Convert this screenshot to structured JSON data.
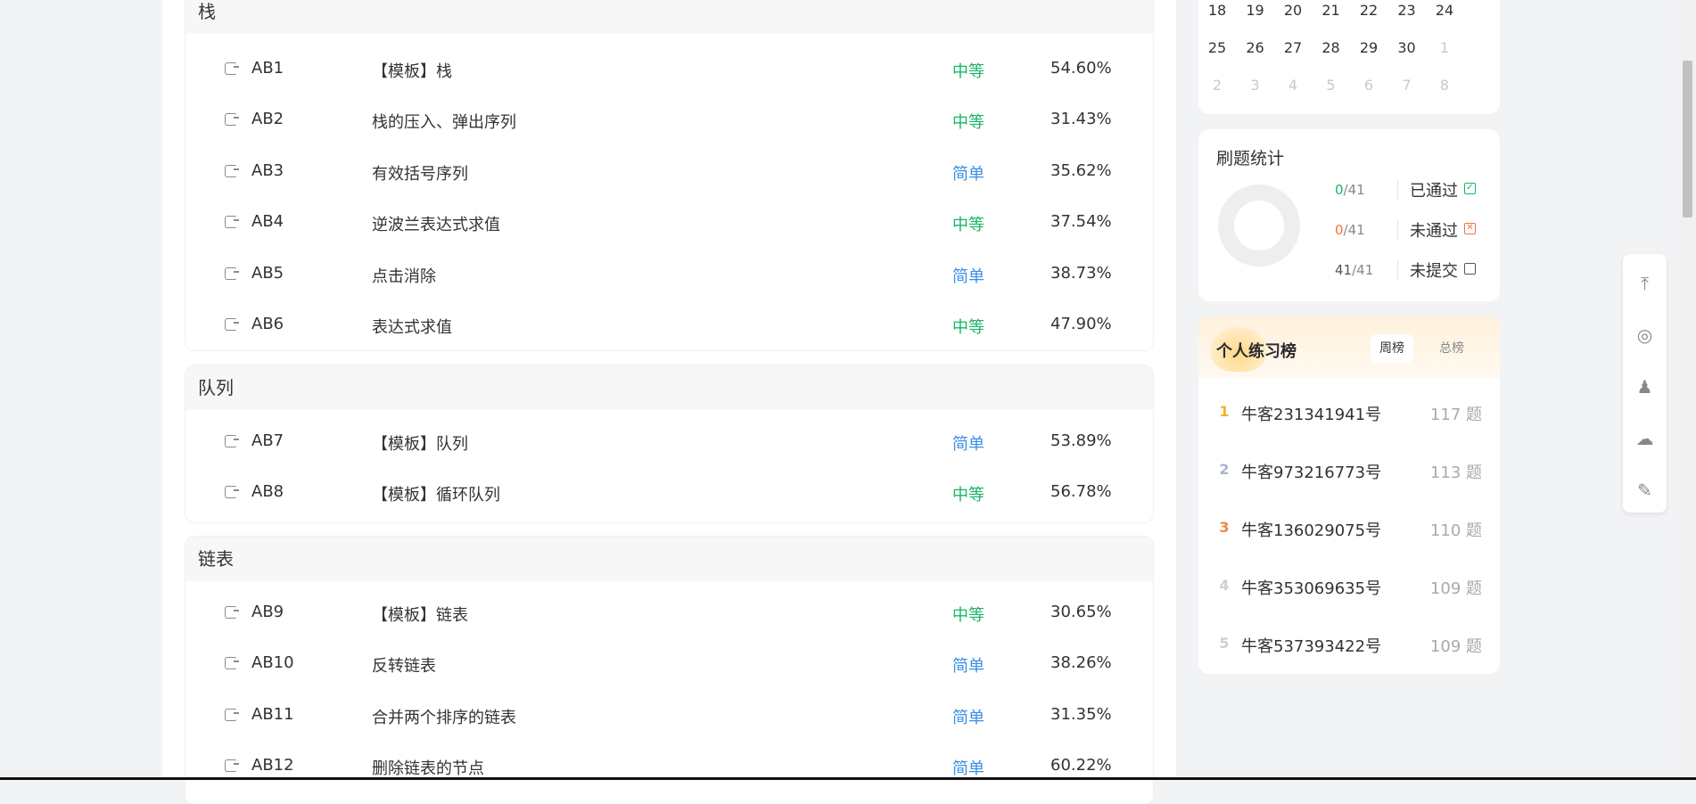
{
  "sections": [
    {
      "title": "栈",
      "rows": [
        {
          "id": "AB1",
          "title": "【模板】栈",
          "difficulty": "中等",
          "rate": "54.60%",
          "level": "med"
        },
        {
          "id": "AB2",
          "title": "栈的压入、弹出序列",
          "difficulty": "中等",
          "rate": "31.43%",
          "level": "med"
        },
        {
          "id": "AB3",
          "title": "有效括号序列",
          "difficulty": "简单",
          "rate": "35.62%",
          "level": "easy"
        },
        {
          "id": "AB4",
          "title": "逆波兰表达式求值",
          "difficulty": "中等",
          "rate": "37.54%",
          "level": "med"
        },
        {
          "id": "AB5",
          "title": "点击消除",
          "difficulty": "简单",
          "rate": "38.73%",
          "level": "easy"
        },
        {
          "id": "AB6",
          "title": "表达式求值",
          "difficulty": "中等",
          "rate": "47.90%",
          "level": "med"
        }
      ]
    },
    {
      "title": "队列",
      "rows": [
        {
          "id": "AB7",
          "title": "【模板】队列",
          "difficulty": "简单",
          "rate": "53.89%",
          "level": "easy"
        },
        {
          "id": "AB8",
          "title": "【模板】循环队列",
          "difficulty": "中等",
          "rate": "56.78%",
          "level": "med"
        }
      ]
    },
    {
      "title": "链表",
      "rows": [
        {
          "id": "AB9",
          "title": "【模板】链表",
          "difficulty": "中等",
          "rate": "30.65%",
          "level": "med"
        },
        {
          "id": "AB10",
          "title": "反转链表",
          "difficulty": "简单",
          "rate": "38.26%",
          "level": "easy"
        },
        {
          "id": "AB11",
          "title": "合并两个排序的链表",
          "difficulty": "简单",
          "rate": "31.35%",
          "level": "easy"
        },
        {
          "id": "AB12",
          "title": "删除链表的节点",
          "difficulty": "简单",
          "rate": "60.22%",
          "level": "easy"
        }
      ]
    }
  ],
  "calendar": {
    "weeks": [
      [
        {
          "d": "18"
        },
        {
          "d": "19"
        },
        {
          "d": "20"
        },
        {
          "d": "21"
        },
        {
          "d": "22"
        },
        {
          "d": "23"
        },
        {
          "d": "24"
        }
      ],
      [
        {
          "d": "25"
        },
        {
          "d": "26"
        },
        {
          "d": "27"
        },
        {
          "d": "28"
        },
        {
          "d": "29"
        },
        {
          "d": "30"
        },
        {
          "d": "1",
          "dim": true
        }
      ],
      [
        {
          "d": "2",
          "dim": true
        },
        {
          "d": "3",
          "dim": true
        },
        {
          "d": "4",
          "dim": true
        },
        {
          "d": "5",
          "dim": true
        },
        {
          "d": "6",
          "dim": true
        },
        {
          "d": "7",
          "dim": true
        },
        {
          "d": "8",
          "dim": true
        }
      ]
    ]
  },
  "stats": {
    "title": "刷题统计",
    "lines": [
      {
        "count": "0",
        "total": "/41",
        "label": "已通过",
        "color": "#18b566",
        "icon": "check-icon",
        "glyph": "✓"
      },
      {
        "count": "0",
        "total": "/41",
        "label": "未通过",
        "color": "#f0743d",
        "icon": "cross-icon",
        "glyph": "✕"
      },
      {
        "count": "41",
        "total": "/41",
        "label": "未提交",
        "color": "#555555",
        "icon": "unsubmitted-icon",
        "glyph": ""
      }
    ]
  },
  "ranking": {
    "title": "个人练习榜",
    "tab_week": "周榜",
    "tab_total": "总榜",
    "items": [
      {
        "medal": "1",
        "name": "牛客231341941号",
        "score": "117 题",
        "color": "#f5b324"
      },
      {
        "medal": "2",
        "name": "牛客973216773号",
        "score": "113 题",
        "color": "#a9b3cf"
      },
      {
        "medal": "3",
        "name": "牛客136029075号",
        "score": "110 题",
        "color": "#f08a3c"
      },
      {
        "medal": "4",
        "name": "牛客353069635号",
        "score": "109 题",
        "color": "#cfcfcf"
      },
      {
        "medal": "5",
        "name": "牛客537393422号",
        "score": "109 题",
        "color": "#cfcfcf"
      }
    ]
  },
  "floatbar": [
    {
      "icon": "back-to-top-icon",
      "glyph": "⤒"
    },
    {
      "icon": "weibo-icon",
      "glyph": "◎"
    },
    {
      "icon": "qq-icon",
      "glyph": "♟"
    },
    {
      "icon": "wechat-icon",
      "glyph": "☁"
    },
    {
      "icon": "feedback-icon",
      "glyph": "✎"
    }
  ]
}
